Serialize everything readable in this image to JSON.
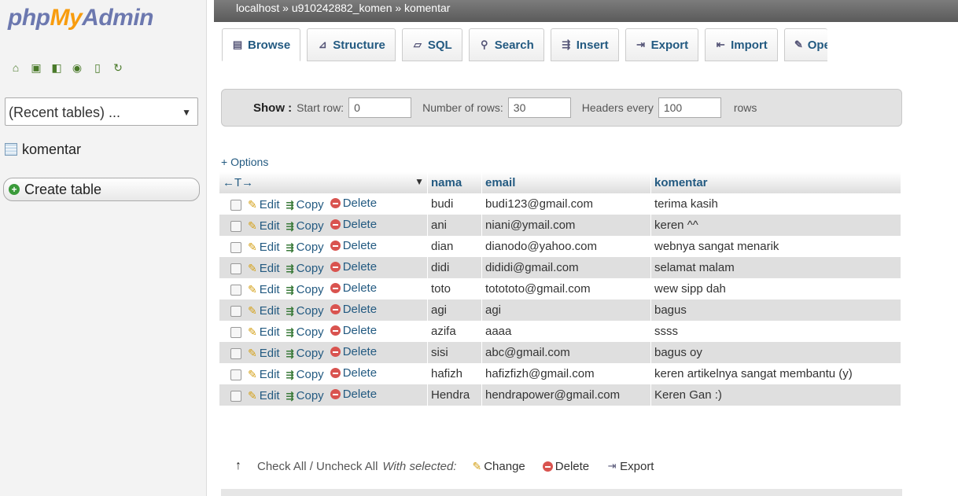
{
  "logo": {
    "php": "php",
    "my": "My",
    "admin": "Admin"
  },
  "sidebar": {
    "recent_label": "(Recent tables) ...",
    "table_item": "komentar",
    "create_table": "Create table"
  },
  "breadcrumb": "localhost » u910242882_komen » komentar",
  "tabs": [
    {
      "label": "Browse",
      "icon": "browse-icon"
    },
    {
      "label": "Structure",
      "icon": "structure-icon"
    },
    {
      "label": "SQL",
      "icon": "sql-icon"
    },
    {
      "label": "Search",
      "icon": "search-icon"
    },
    {
      "label": "Insert",
      "icon": "insert-icon"
    },
    {
      "label": "Export",
      "icon": "export-icon"
    },
    {
      "label": "Import",
      "icon": "import-icon"
    },
    {
      "label": "Ope",
      "icon": "operations-icon"
    }
  ],
  "show": {
    "label": "Show :",
    "start_row_label": "Start row:",
    "start_row": "0",
    "num_rows_label": "Number of rows:",
    "num_rows": "30",
    "headers_label": "Headers every",
    "headers_every": "100",
    "rows_label": "rows"
  },
  "options_label": "+ Options",
  "table": {
    "nav_arrows": "←T→",
    "sort_icon": "▼",
    "columns": [
      "nama",
      "email",
      "komentar"
    ],
    "action_labels": {
      "edit": "Edit",
      "copy": "Copy",
      "delete": "Delete"
    },
    "rows": [
      [
        "budi",
        "budi123@gmail.com",
        "terima kasih"
      ],
      [
        "ani",
        "niani@ymail.com",
        "keren ^^"
      ],
      [
        "dian",
        "dianodo@yahoo.com",
        "webnya sangat menarik"
      ],
      [
        "didi",
        "dididi@gmail.com",
        "selamat malam"
      ],
      [
        "toto",
        "totototo@gmail.com",
        "wew sipp dah"
      ],
      [
        "agi",
        "agi",
        "bagus"
      ],
      [
        "azifa",
        "aaaa",
        "ssss"
      ],
      [
        "sisi",
        "abc@gmail.com",
        "bagus oy"
      ],
      [
        "hafizh",
        "hafizfizh@gmail.com",
        "keren artikelnya sangat membantu (y)"
      ],
      [
        "Hendra",
        "hendrapower@gmail.com",
        "Keren Gan :)"
      ]
    ]
  },
  "footer": {
    "check_all": "Check All / Uncheck All",
    "with_selected": "With selected:",
    "change": "Change",
    "delete": "Delete",
    "export": "Export"
  }
}
